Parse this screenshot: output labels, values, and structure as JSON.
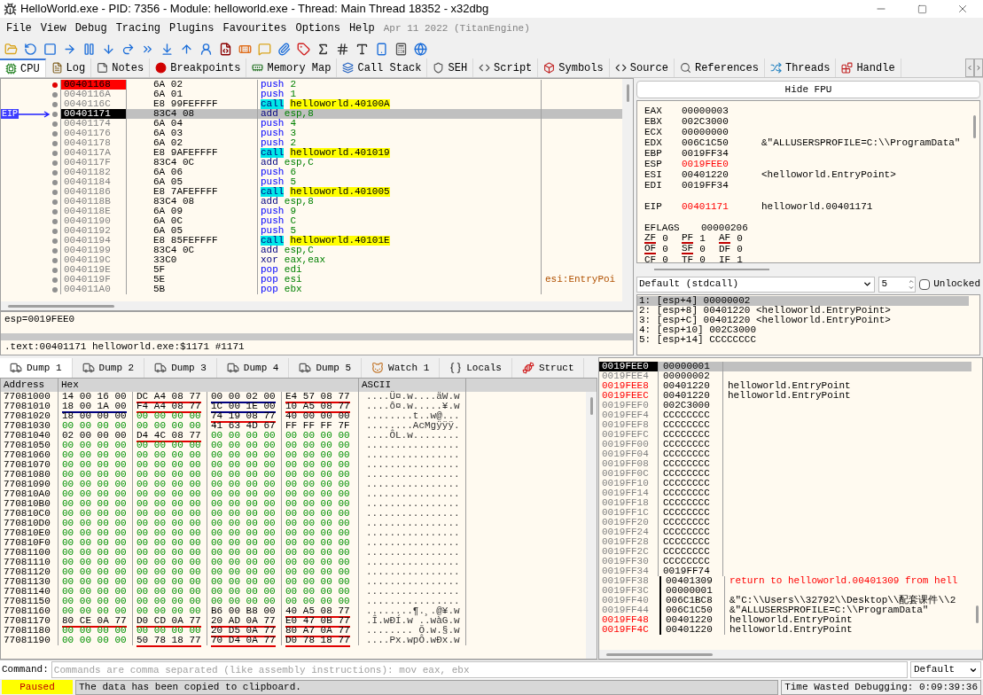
{
  "window": {
    "title": "HelloWorld.exe - PID: 7356 - Module: helloworld.exe - Thread: Main Thread 18352 - x32dbg"
  },
  "menu": [
    "File",
    "View",
    "Debug",
    "Tracing",
    "Plugins",
    "Favourites",
    "Options",
    "Help"
  ],
  "build_date": "Apr 11 2022 (TitanEngine)",
  "tabs": [
    {
      "label": "CPU",
      "selected": true
    },
    {
      "label": "Log",
      "selected": false
    },
    {
      "label": "Notes",
      "selected": false
    },
    {
      "label": "Breakpoints",
      "selected": false
    },
    {
      "label": "Memory Map",
      "selected": false
    },
    {
      "label": "Call Stack",
      "selected": false
    },
    {
      "label": "SEH",
      "selected": false
    },
    {
      "label": "Script",
      "selected": false
    },
    {
      "label": "Symbols",
      "selected": false
    },
    {
      "label": "Source",
      "selected": false
    },
    {
      "label": "References",
      "selected": false
    },
    {
      "label": "Threads",
      "selected": false
    },
    {
      "label": "Handle",
      "selected": false
    }
  ],
  "disassembly": {
    "eip_label": "EIP",
    "rows": [
      {
        "address": "00401168",
        "bytes": "6A 02",
        "mnemonic": "push",
        "operand": "2",
        "kind": "push",
        "breakpoint": true,
        "selected": false
      },
      {
        "address": "0040116A",
        "bytes": "6A 01",
        "mnemonic": "push",
        "operand": "1",
        "kind": "push",
        "breakpoint": false,
        "selected": false
      },
      {
        "address": "0040116C",
        "bytes": "E8 99FEFFFF",
        "mnemonic": "call",
        "operand": "helloworld.40100A",
        "kind": "call",
        "breakpoint": false,
        "selected": false
      },
      {
        "address": "00401171",
        "bytes": "83C4 08",
        "mnemonic": "add",
        "operand": "esp,8",
        "kind": "plain",
        "breakpoint": false,
        "selected": true
      },
      {
        "address": "00401174",
        "bytes": "6A 04",
        "mnemonic": "push",
        "operand": "4",
        "kind": "push",
        "breakpoint": false,
        "selected": false
      },
      {
        "address": "00401176",
        "bytes": "6A 03",
        "mnemonic": "push",
        "operand": "3",
        "kind": "push",
        "breakpoint": false,
        "selected": false
      },
      {
        "address": "00401178",
        "bytes": "6A 02",
        "mnemonic": "push",
        "operand": "2",
        "kind": "push",
        "breakpoint": false,
        "selected": false
      },
      {
        "address": "0040117A",
        "bytes": "E8 9AFEFFFF",
        "mnemonic": "call",
        "operand": "helloworld.401019",
        "kind": "call",
        "breakpoint": false,
        "selected": false
      },
      {
        "address": "0040117F",
        "bytes": "83C4 0C",
        "mnemonic": "add",
        "operand": "esp,C",
        "kind": "plain",
        "breakpoint": false,
        "selected": false
      },
      {
        "address": "00401182",
        "bytes": "6A 06",
        "mnemonic": "push",
        "operand": "6",
        "kind": "push",
        "breakpoint": false,
        "selected": false
      },
      {
        "address": "00401184",
        "bytes": "6A 05",
        "mnemonic": "push",
        "operand": "5",
        "kind": "push",
        "breakpoint": false,
        "selected": false
      },
      {
        "address": "00401186",
        "bytes": "E8 7AFEFFFF",
        "mnemonic": "call",
        "operand": "helloworld.401005",
        "kind": "call",
        "breakpoint": false,
        "selected": false
      },
      {
        "address": "0040118B",
        "bytes": "83C4 08",
        "mnemonic": "add",
        "operand": "esp,8",
        "kind": "plain",
        "breakpoint": false,
        "selected": false
      },
      {
        "address": "0040118E",
        "bytes": "6A 09",
        "mnemonic": "push",
        "operand": "9",
        "kind": "push",
        "breakpoint": false,
        "selected": false
      },
      {
        "address": "00401190",
        "bytes": "6A 0C",
        "mnemonic": "push",
        "operand": "C",
        "kind": "push",
        "breakpoint": false,
        "selected": false
      },
      {
        "address": "00401192",
        "bytes": "6A 05",
        "mnemonic": "push",
        "operand": "5",
        "kind": "push",
        "breakpoint": false,
        "selected": false
      },
      {
        "address": "00401194",
        "bytes": "E8 85FEFFFF",
        "mnemonic": "call",
        "operand": "helloworld.40101E",
        "kind": "call",
        "breakpoint": false,
        "selected": false
      },
      {
        "address": "00401199",
        "bytes": "83C4 0C",
        "mnemonic": "add",
        "operand": "esp,C",
        "kind": "plain",
        "breakpoint": false,
        "selected": false
      },
      {
        "address": "0040119C",
        "bytes": "33C0",
        "mnemonic": "xor",
        "operand": "eax,eax",
        "kind": "plain",
        "breakpoint": false,
        "selected": false
      },
      {
        "address": "0040119E",
        "bytes": "5F",
        "mnemonic": "pop",
        "operand": "edi",
        "kind": "push",
        "breakpoint": false,
        "selected": false
      },
      {
        "address": "0040119F",
        "bytes": "5E",
        "mnemonic": "pop",
        "operand": "esi",
        "kind": "push",
        "breakpoint": false,
        "selected": false,
        "comment": "esi:EntryPoi"
      },
      {
        "address": "004011A0",
        "bytes": "5B",
        "mnemonic": "pop",
        "operand": "ebx",
        "kind": "push",
        "breakpoint": false,
        "selected": false
      }
    ]
  },
  "info": [
    "esp=0019FEE0",
    ".text:00401171 helloworld.exe:$1171 #1171"
  ],
  "registers": {
    "button": "Hide FPU",
    "groups": [
      [
        {
          "name": "EAX",
          "value": "00000003",
          "changed": false
        },
        {
          "name": "EBX",
          "value": "002C3000",
          "changed": false
        },
        {
          "name": "ECX",
          "value": "00000000",
          "changed": false
        },
        {
          "name": "EDX",
          "value": "006C1C50",
          "changed": false,
          "comment": "&\"ALLUSERSPROFILE=C:\\\\ProgramData\""
        },
        {
          "name": "EBP",
          "value": "0019FF34",
          "changed": false
        },
        {
          "name": "ESP",
          "value": "0019FEE0",
          "changed": true
        },
        {
          "name": "ESI",
          "value": "00401220",
          "changed": false,
          "comment": "<helloworld.EntryPoint>"
        },
        {
          "name": "EDI",
          "value": "0019FF34",
          "changed": false
        }
      ],
      [
        {
          "name": "EIP",
          "value": "00401171",
          "changed": true,
          "comment": "helloworld.00401171"
        }
      ]
    ],
    "eflags": {
      "name": "EFLAGS",
      "value": "00000206"
    },
    "flags": [
      [
        {
          "name": "ZF",
          "value": "0",
          "marked": true
        },
        {
          "name": "PF",
          "value": "1",
          "marked": true
        },
        {
          "name": "AF",
          "value": "0",
          "marked": true
        }
      ],
      [
        {
          "name": "OF",
          "value": "0",
          "marked": true
        },
        {
          "name": "SF",
          "value": "0",
          "marked": true
        },
        {
          "name": "DF",
          "value": "0",
          "marked": false
        }
      ],
      [
        {
          "name": "CF",
          "value": "0",
          "marked": false
        },
        {
          "name": "TF",
          "value": "0",
          "marked": false
        },
        {
          "name": "IF",
          "value": "1",
          "marked": false
        }
      ]
    ]
  },
  "call_convention": {
    "value": "Default (stdcall)",
    "count": "5",
    "unlocked_label": "Unlocked",
    "unlocked": false
  },
  "arguments": [
    {
      "text": "1: [esp+4] 00000002",
      "selected": true
    },
    {
      "text": "2: [esp+8] 00401220 <helloworld.EntryPoint>",
      "selected": false
    },
    {
      "text": "3: [esp+C] 00401220 <helloworld.EntryPoint>",
      "selected": false
    },
    {
      "text": "4: [esp+10] 002C3000",
      "selected": false
    },
    {
      "text": "5: [esp+14] CCCCCCCC",
      "selected": false
    }
  ],
  "dump_tabs": [
    {
      "label": "Dump 1",
      "selected": true
    },
    {
      "label": "Dump 2",
      "selected": false
    },
    {
      "label": "Dump 3",
      "selected": false
    },
    {
      "label": "Dump 4",
      "selected": false
    },
    {
      "label": "Dump 5",
      "selected": false
    },
    {
      "label": "Watch 1",
      "selected": false
    },
    {
      "label": "Locals",
      "selected": false
    },
    {
      "label": "Struct",
      "selected": false
    }
  ],
  "dump": {
    "columns": [
      "Address",
      "Hex",
      "ASCII"
    ],
    "rows": [
      {
        "address": "77081000",
        "groups": [
          {
            "bytes": "14 00 16 00"
          },
          {
            "bytes": "DC A4 08 77",
            "color": "#e00000"
          },
          {
            "bytes": "00 00 02 00",
            "color": "#000080"
          },
          {
            "bytes": "E4 57 08 77",
            "color": "#e00000"
          }
        ],
        "ascii": "....Ü¤.w....äW.w"
      },
      {
        "address": "77081010",
        "groups": [
          {
            "bytes": "18 00 1A 00",
            "color": "#000080"
          },
          {
            "bytes": "F4 A4 08 77",
            "color": "#e00000"
          },
          {
            "bytes": "1C 00 1E 00",
            "color": "#000080"
          },
          {
            "bytes": "10 A5 08 77",
            "color": "#e00000"
          }
        ],
        "ascii": "....ô¤.w.....¥.w"
      },
      {
        "address": "77081020",
        "groups": [
          {
            "bytes": "18 00 00 00"
          },
          {
            "bytes": "00 00 00 00"
          },
          {
            "bytes": "74 19 08 77",
            "color": "#e00000"
          },
          {
            "bytes": "40 00 00 00"
          }
        ],
        "ascii": "........t..w@..."
      },
      {
        "address": "77081030",
        "groups": [
          {
            "bytes": "00 00 00 00"
          },
          {
            "bytes": "00 00 00 00"
          },
          {
            "bytes": "41 63 4D 67"
          },
          {
            "bytes": "FF FF FF 7F"
          }
        ],
        "ascii": "........AcMgÿÿÿ."
      },
      {
        "address": "77081040",
        "groups": [
          {
            "bytes": "02 00 00 00"
          },
          {
            "bytes": "D4 4C 08 77",
            "color": "#e00000"
          },
          {
            "bytes": "00 00 00 00"
          },
          {
            "bytes": "00 00 00 00"
          }
        ],
        "ascii": "....ÔL.w........"
      },
      {
        "address": "77081050",
        "groups": [
          {
            "bytes": "00 00 00 00"
          },
          {
            "bytes": "00 00 00 00"
          },
          {
            "bytes": "00 00 00 00"
          },
          {
            "bytes": "00 00 00 00"
          }
        ],
        "ascii": "................"
      },
      {
        "address": "77081060",
        "groups": [
          {
            "bytes": "00 00 00 00"
          },
          {
            "bytes": "00 00 00 00"
          },
          {
            "bytes": "00 00 00 00"
          },
          {
            "bytes": "00 00 00 00"
          }
        ],
        "ascii": "................"
      },
      {
        "address": "77081070",
        "groups": [
          {
            "bytes": "00 00 00 00"
          },
          {
            "bytes": "00 00 00 00"
          },
          {
            "bytes": "00 00 00 00"
          },
          {
            "bytes": "00 00 00 00"
          }
        ],
        "ascii": "................"
      },
      {
        "address": "77081080",
        "groups": [
          {
            "bytes": "00 00 00 00"
          },
          {
            "bytes": "00 00 00 00"
          },
          {
            "bytes": "00 00 00 00"
          },
          {
            "bytes": "00 00 00 00"
          }
        ],
        "ascii": "................"
      },
      {
        "address": "77081090",
        "groups": [
          {
            "bytes": "00 00 00 00"
          },
          {
            "bytes": "00 00 00 00"
          },
          {
            "bytes": "00 00 00 00"
          },
          {
            "bytes": "00 00 00 00"
          }
        ],
        "ascii": "................"
      },
      {
        "address": "770810A0",
        "groups": [
          {
            "bytes": "00 00 00 00"
          },
          {
            "bytes": "00 00 00 00"
          },
          {
            "bytes": "00 00 00 00"
          },
          {
            "bytes": "00 00 00 00"
          }
        ],
        "ascii": "................"
      },
      {
        "address": "770810B0",
        "groups": [
          {
            "bytes": "00 00 00 00"
          },
          {
            "bytes": "00 00 00 00"
          },
          {
            "bytes": "00 00 00 00"
          },
          {
            "bytes": "00 00 00 00"
          }
        ],
        "ascii": "................"
      },
      {
        "address": "770810C0",
        "groups": [
          {
            "bytes": "00 00 00 00"
          },
          {
            "bytes": "00 00 00 00"
          },
          {
            "bytes": "00 00 00 00"
          },
          {
            "bytes": "00 00 00 00"
          }
        ],
        "ascii": "................"
      },
      {
        "address": "770810D0",
        "groups": [
          {
            "bytes": "00 00 00 00"
          },
          {
            "bytes": "00 00 00 00"
          },
          {
            "bytes": "00 00 00 00"
          },
          {
            "bytes": "00 00 00 00"
          }
        ],
        "ascii": "................"
      },
      {
        "address": "770810E0",
        "groups": [
          {
            "bytes": "00 00 00 00"
          },
          {
            "bytes": "00 00 00 00"
          },
          {
            "bytes": "00 00 00 00"
          },
          {
            "bytes": "00 00 00 00"
          }
        ],
        "ascii": "................"
      },
      {
        "address": "770810F0",
        "groups": [
          {
            "bytes": "00 00 00 00"
          },
          {
            "bytes": "00 00 00 00"
          },
          {
            "bytes": "00 00 00 00"
          },
          {
            "bytes": "00 00 00 00"
          }
        ],
        "ascii": "................"
      },
      {
        "address": "77081100",
        "groups": [
          {
            "bytes": "00 00 00 00"
          },
          {
            "bytes": "00 00 00 00"
          },
          {
            "bytes": "00 00 00 00"
          },
          {
            "bytes": "00 00 00 00"
          }
        ],
        "ascii": "................"
      },
      {
        "address": "77081110",
        "groups": [
          {
            "bytes": "00 00 00 00"
          },
          {
            "bytes": "00 00 00 00"
          },
          {
            "bytes": "00 00 00 00"
          },
          {
            "bytes": "00 00 00 00"
          }
        ],
        "ascii": "................"
      },
      {
        "address": "77081120",
        "groups": [
          {
            "bytes": "00 00 00 00"
          },
          {
            "bytes": "00 00 00 00"
          },
          {
            "bytes": "00 00 00 00"
          },
          {
            "bytes": "00 00 00 00"
          }
        ],
        "ascii": "................"
      },
      {
        "address": "77081130",
        "groups": [
          {
            "bytes": "00 00 00 00"
          },
          {
            "bytes": "00 00 00 00"
          },
          {
            "bytes": "00 00 00 00"
          },
          {
            "bytes": "00 00 00 00"
          }
        ],
        "ascii": "................"
      },
      {
        "address": "77081140",
        "groups": [
          {
            "bytes": "00 00 00 00"
          },
          {
            "bytes": "00 00 00 00"
          },
          {
            "bytes": "00 00 00 00"
          },
          {
            "bytes": "00 00 00 00"
          }
        ],
        "ascii": "................"
      },
      {
        "address": "77081150",
        "groups": [
          {
            "bytes": "00 00 00 00"
          },
          {
            "bytes": "00 00 00 00"
          },
          {
            "bytes": "00 00 00 00"
          },
          {
            "bytes": "00 00 00 00"
          }
        ],
        "ascii": "................"
      },
      {
        "address": "77081160",
        "groups": [
          {
            "bytes": "00 00 00 00"
          },
          {
            "bytes": "00 00 00 00"
          },
          {
            "bytes": "B6 00 B8 00"
          },
          {
            "bytes": "40 A5 08 77",
            "color": "#e00000"
          }
        ],
        "ascii": "........¶.¸.@¥.w"
      },
      {
        "address": "77081170",
        "groups": [
          {
            "bytes": "80 CE 0A 77",
            "color": "#e00000"
          },
          {
            "bytes": "D0 CD 0A 77",
            "color": "#e00000"
          },
          {
            "bytes": "20 AD 0A 77",
            "color": "#e00000"
          },
          {
            "bytes": "E0 47 0B 77",
            "color": "#e00000"
          }
        ],
        "ascii": ".Î.wÐÍ.w ..wàG.w"
      },
      {
        "address": "77081180",
        "groups": [
          {
            "bytes": "00 00 00 00"
          },
          {
            "bytes": "00 00 00 00"
          },
          {
            "bytes": "20 D5 0A 77",
            "color": "#e00000"
          },
          {
            "bytes": "80 A7 0A 77",
            "color": "#e00000"
          }
        ],
        "ascii": "........ Õ.w.§.w"
      },
      {
        "address": "77081190",
        "groups": [
          {
            "bytes": "00 00 00 00"
          },
          {
            "bytes": "50 78 18 77",
            "color": "#e00000"
          },
          {
            "bytes": "70 D4 0A 77",
            "color": "#e00000"
          },
          {
            "bytes": "D0 78 18 77",
            "color": "#e00000"
          }
        ],
        "ascii": "....Px.wpÔ.wÐx.w"
      }
    ]
  },
  "stack": [
    {
      "address": "0019FEE0",
      "value": "00000001",
      "kind": "plain",
      "selected": true
    },
    {
      "address": "0019FEE4",
      "value": "00000002",
      "kind": "plain",
      "selected": false
    },
    {
      "address": "0019FEE8",
      "value": "00401220",
      "comment": "helloworld.EntryPoint",
      "kind": "pointer",
      "selected": false
    },
    {
      "address": "0019FEEC",
      "value": "00401220",
      "comment": "helloworld.EntryPoint",
      "kind": "pointer",
      "selected": false
    },
    {
      "address": "0019FEF0",
      "value": "002C3000",
      "kind": "plain",
      "selected": false
    },
    {
      "address": "0019FEF4",
      "value": "CCCCCCCC",
      "kind": "plain",
      "selected": false
    },
    {
      "address": "0019FEF8",
      "value": "CCCCCCCC",
      "kind": "plain",
      "selected": false
    },
    {
      "address": "0019FEFC",
      "value": "CCCCCCCC",
      "kind": "plain",
      "selected": false
    },
    {
      "address": "0019FF00",
      "value": "CCCCCCCC",
      "kind": "plain",
      "selected": false
    },
    {
      "address": "0019FF04",
      "value": "CCCCCCCC",
      "kind": "plain",
      "selected": false
    },
    {
      "address": "0019FF08",
      "value": "CCCCCCCC",
      "kind": "plain",
      "selected": false
    },
    {
      "address": "0019FF0C",
      "value": "CCCCCCCC",
      "kind": "plain",
      "selected": false
    },
    {
      "address": "0019FF10",
      "value": "CCCCCCCC",
      "kind": "plain",
      "selected": false
    },
    {
      "address": "0019FF14",
      "value": "CCCCCCCC",
      "kind": "plain",
      "selected": false
    },
    {
      "address": "0019FF18",
      "value": "CCCCCCCC",
      "kind": "plain",
      "selected": false
    },
    {
      "address": "0019FF1C",
      "value": "CCCCCCCC",
      "kind": "plain",
      "selected": false
    },
    {
      "address": "0019FF20",
      "value": "CCCCCCCC",
      "kind": "plain",
      "selected": false
    },
    {
      "address": "0019FF24",
      "value": "CCCCCCCC",
      "kind": "plain",
      "selected": false
    },
    {
      "address": "0019FF28",
      "value": "CCCCCCCC",
      "kind": "plain",
      "selected": false
    },
    {
      "address": "0019FF2C",
      "value": "CCCCCCCC",
      "kind": "plain",
      "selected": false
    },
    {
      "address": "0019FF30",
      "value": "CCCCCCCC",
      "kind": "plain",
      "selected": false
    },
    {
      "address": "0019FF34",
      "value": "0019FF74",
      "kind": "plain",
      "selected": false
    },
    {
      "address": "0019FF38",
      "value": "00401309",
      "comment": "return to helloworld.00401309 from hell",
      "kind": "return",
      "selected": false
    },
    {
      "address": "0019FF3C",
      "value": "00000001",
      "kind": "frame",
      "selected": false
    },
    {
      "address": "0019FF40",
      "value": "006C1BC8",
      "comment": "&\"C:\\\\Users\\\\32792\\\\Desktop\\\\配套课件\\\\2",
      "kind": "frame",
      "selected": false
    },
    {
      "address": "0019FF44",
      "value": "006C1C50",
      "comment": "&\"ALLUSERSPROFILE=C:\\\\ProgramData\"",
      "kind": "frame",
      "selected": false
    },
    {
      "address": "0019FF48",
      "value": "00401220",
      "comment": "helloworld.EntryPoint",
      "kind": "framepointer",
      "selected": false
    },
    {
      "address": "0019FF4C",
      "value": "00401220",
      "comment": "helloworld.EntryPoint",
      "kind": "framepointer",
      "selected": false
    }
  ],
  "command": {
    "label": "Command:",
    "placeholder": "Commands are comma separated (like assembly instructions): mov eax, ebx",
    "mode": "Default"
  },
  "status": {
    "state": "Paused",
    "message": "The data has been copied to clipboard.",
    "time": "Time Wasted Debugging: 0:09:39:36"
  }
}
